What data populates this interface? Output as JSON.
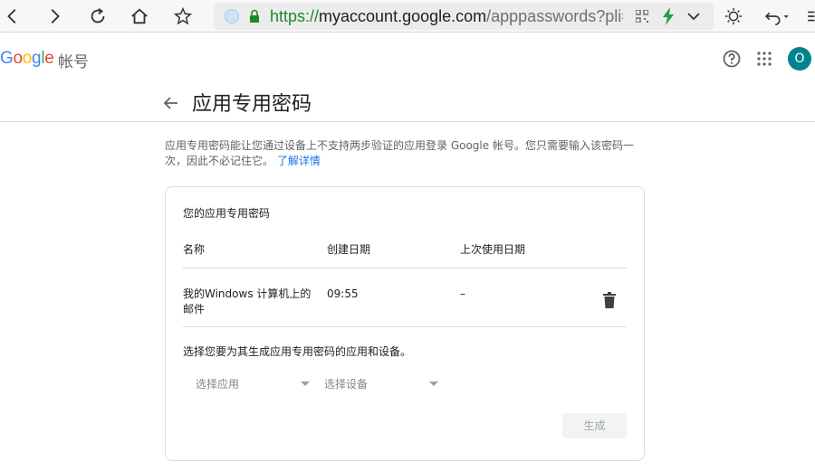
{
  "browser": {
    "url_scheme": "https://",
    "url_host": "myaccount.google.com",
    "url_path": "/apppasswords?pli="
  },
  "header": {
    "logo_text": "Google",
    "product_name": "帐号",
    "avatar_letter": "O"
  },
  "page": {
    "title": "应用专用密码",
    "description": "应用专用密码能让您通过设备上不支持两步验证的应用登录 Google 帐号。您只需要输入该密码一次，因此不必记住它。",
    "learn_more": "了解详情"
  },
  "card": {
    "title": "您的应用专用密码",
    "columns": [
      "名称",
      "创建日期",
      "上次使用日期"
    ],
    "rows": [
      {
        "name": "我的Windows 计算机上的邮件",
        "created": "09:55",
        "last_used": "–"
      }
    ],
    "select_prompt": "选择您要为其生成应用专用密码的应用和设备。",
    "select_app": "选择应用",
    "select_device": "选择设备",
    "generate_button": "生成"
  },
  "colors": {
    "accent": "#1a73e8",
    "avatar": "#00838f",
    "url_scheme": "#1a8a2e"
  }
}
